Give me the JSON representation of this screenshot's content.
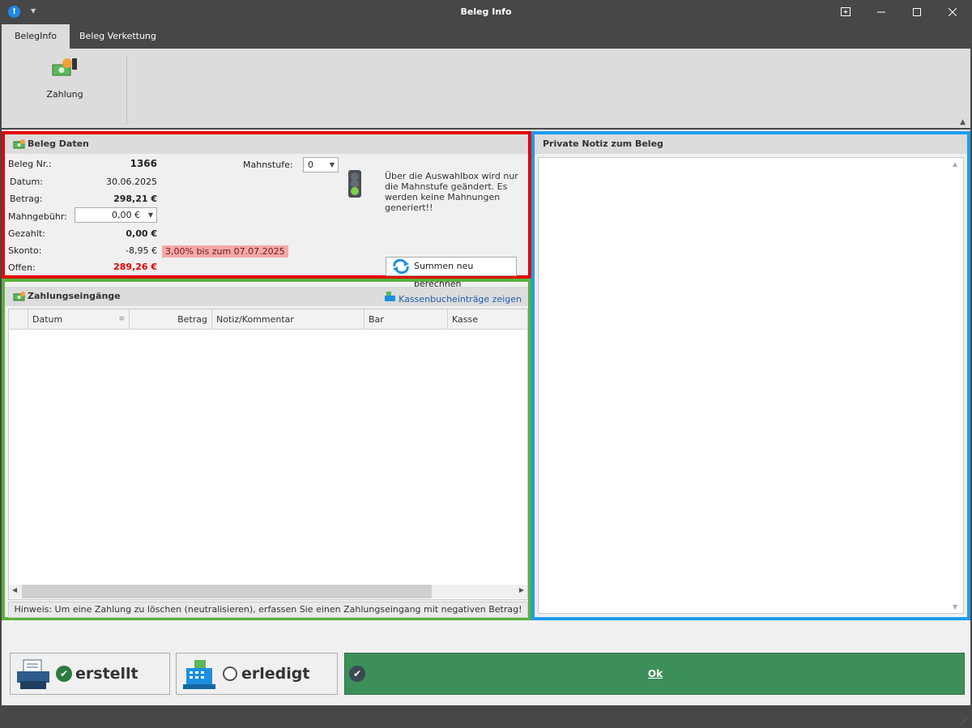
{
  "window": {
    "title": "Beleg Info",
    "app_icon": "!"
  },
  "tabs": [
    {
      "label": "BelegInfo"
    },
    {
      "label": "Beleg Verkettung"
    }
  ],
  "ribbon": {
    "zahlung_label": "Zahlung"
  },
  "beleg_daten": {
    "header": "Beleg Daten",
    "beleg_nr_label": "Beleg Nr.:",
    "beleg_nr_value": "1366",
    "datum_label": "Datum:",
    "datum_value": "30.06.2025",
    "betrag_label": "Betrag:",
    "betrag_value": "298,21 €",
    "mahngebuehr_label": "Mahngebühr:",
    "mahngebuehr_value": "0,00 €",
    "gezahlt_label": "Gezahlt:",
    "gezahlt_value": "0,00 €",
    "skonto_label": "Skonto:",
    "skonto_value": "-8,95 €",
    "skonto_badge": "3,00% bis zum 07.07.2025",
    "offen_label": "Offen:",
    "offen_value": "289,26 €",
    "mahnstufe_label": "Mahnstufe:",
    "mahnstufe_value": "0",
    "info_text": "Über die Auswahlbox wird nur die Mahnstufe geändert. Es werden keine Mahnungen generiert!!",
    "recalc_button": "Summen neu berechnen",
    "colors": {
      "offen": "#e30000",
      "traffic_green": "#7fd14a"
    }
  },
  "zahlungseingaenge": {
    "header": "Zahlungseingänge",
    "kasse_link": "Kassenbucheinträge zeigen",
    "columns": [
      "Datum",
      "Betrag",
      "Notiz/Kommentar",
      "Bar",
      "Kasse"
    ],
    "rows": [],
    "hint": "Hinweis: Um eine Zahlung zu löschen (neutralisieren), erfassen Sie einen Zahlungseingang mit negativen Betrag!"
  },
  "notiz": {
    "header": "Private Notiz zum Beleg",
    "value": ""
  },
  "footer": {
    "erstellt_label": "erstellt",
    "erledigt_label": "erledigt",
    "ok_label": "Ok",
    "ok_color": "#3d8f5a"
  }
}
